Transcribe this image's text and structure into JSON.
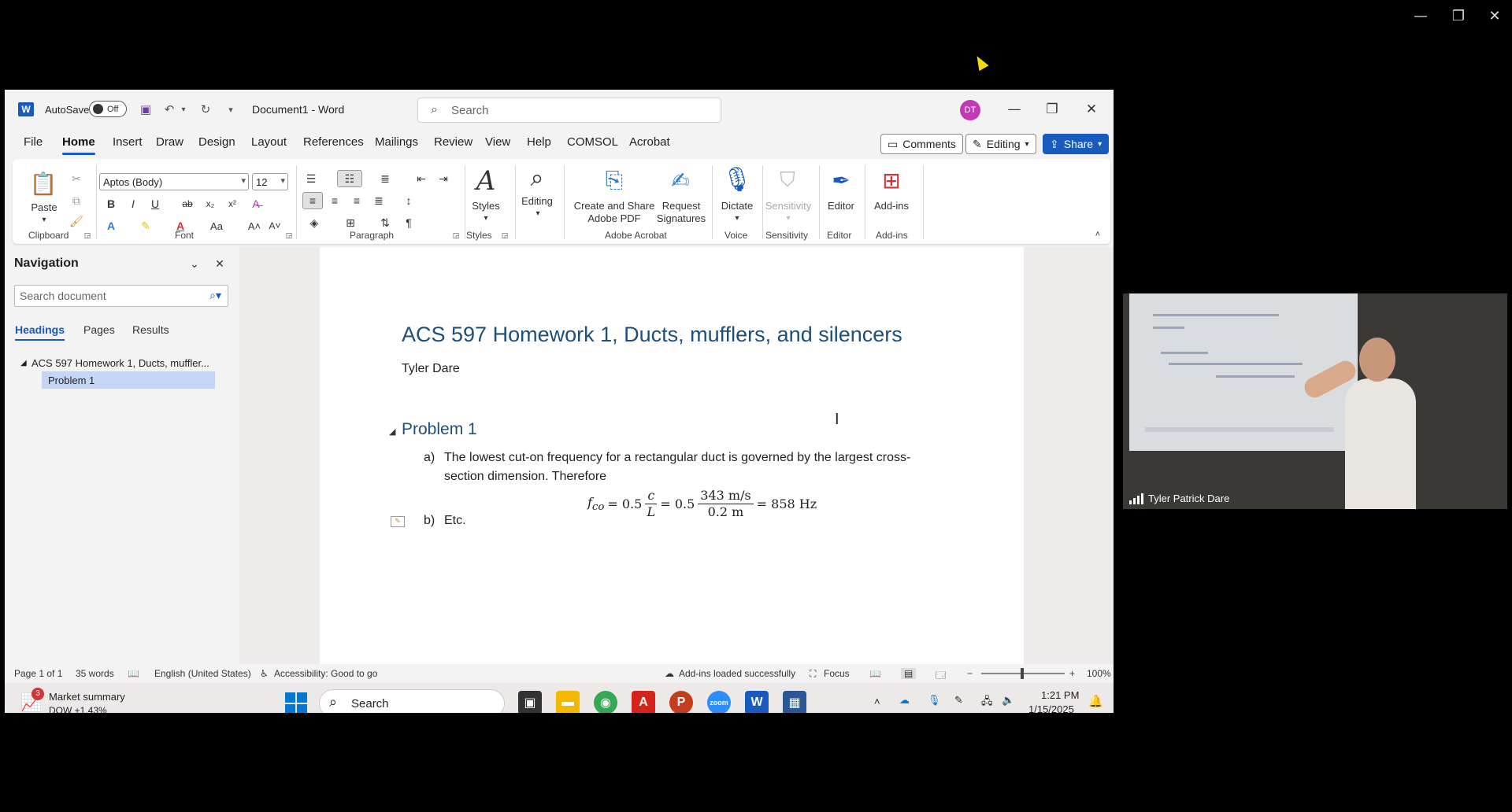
{
  "window": {
    "autosave_label": "AutoSave",
    "autosave_state": "Off",
    "doc_title": "Document1  -  Word",
    "search_placeholder": "Search",
    "avatar_initials": "DT"
  },
  "menu": {
    "tabs": [
      "File",
      "Home",
      "Insert",
      "Draw",
      "Design",
      "Layout",
      "References",
      "Mailings",
      "Review",
      "View",
      "Help",
      "COMSOL",
      "Acrobat"
    ],
    "active": "Home",
    "comments_label": "Comments",
    "editing_label": "Editing",
    "share_label": "Share"
  },
  "ribbon": {
    "paste_label": "Paste",
    "font_name": "Aptos (Body)",
    "font_size": "12",
    "styles_label": "Styles",
    "editing_label": "Editing",
    "create_share_label": "Create and Share Adobe PDF",
    "request_sig_label": "Request Signatures",
    "dictate_label": "Dictate",
    "sensitivity_label": "Sensitivity",
    "editor_label": "Editor",
    "addins_label": "Add-ins",
    "groups": {
      "clipboard": "Clipboard",
      "font": "Font",
      "paragraph": "Paragraph",
      "styles": "Styles",
      "adobe": "Adobe Acrobat",
      "voice": "Voice",
      "sensitivity": "Sensitivity",
      "editor": "Editor",
      "addins": "Add-ins"
    }
  },
  "navigation": {
    "title": "Navigation",
    "search_placeholder": "Search document",
    "tabs": [
      "Headings",
      "Pages",
      "Results"
    ],
    "heading_1": "ACS 597 Homework 1, Ducts, muffler...",
    "heading_2": "Problem 1"
  },
  "document": {
    "title": "ACS 597 Homework 1, Ducts, mufflers, and silencers",
    "author": "Tyler Dare",
    "problem_heading": "Problem 1",
    "item_a_marker": "a)",
    "item_a_text_1": "The lowest cut-on frequency for a rectangular duct is governed by the largest cross-",
    "item_a_text_2": "section dimension. Therefore",
    "equation": {
      "lhs": "f",
      "lhs_sub": "co",
      "eq1": "= 0.5",
      "frac1_num": "c",
      "frac1_den": "L",
      "eq2": "= 0.5",
      "frac2_num": "343 m/s",
      "frac2_den": "0.2 m",
      "result": "= 858 Hz"
    },
    "item_b_marker": "b)",
    "item_b_text": "Etc."
  },
  "status": {
    "page": "Page 1 of 1",
    "words": "35 words",
    "language": "English (United States)",
    "accessibility": "Accessibility: Good to go",
    "addins": "Add-ins loaded successfully",
    "focus": "Focus",
    "zoom": "100%"
  },
  "taskbar": {
    "widget_title": "Market summary",
    "widget_value": "DOW +1.43%",
    "widget_badge": "3",
    "search_label": "Search",
    "time": "1:21 PM",
    "date": "1/15/2025"
  },
  "webcam": {
    "name": "Tyler Patrick Dare"
  },
  "colors": {
    "accent": "#185abd",
    "heading": "#1f4e79",
    "avatar": "#c239b3"
  }
}
